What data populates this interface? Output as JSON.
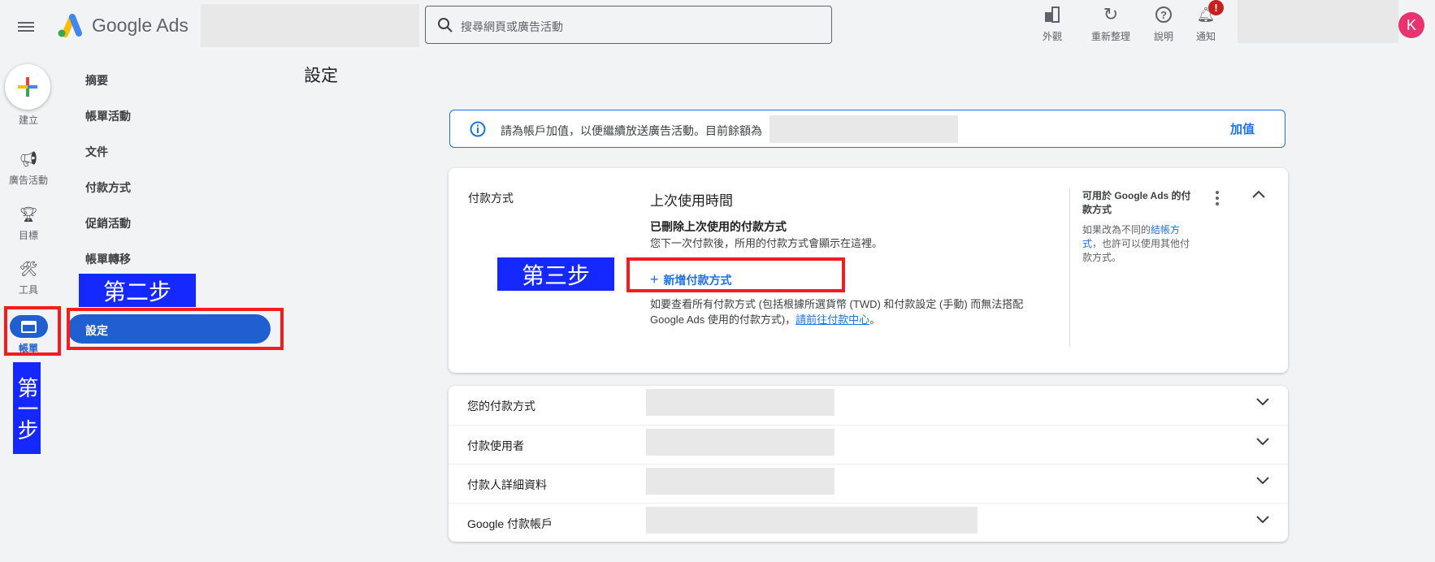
{
  "header": {
    "app_name": "Google Ads",
    "search_placeholder": "搜尋網頁或廣告活動",
    "actions": [
      {
        "label": "外觀",
        "icon": "appearance-icon"
      },
      {
        "label": "重新整理",
        "icon": "refresh-icon"
      },
      {
        "label": "說明",
        "icon": "help-icon"
      },
      {
        "label": "通知",
        "icon": "bell-icon",
        "badge": "!"
      }
    ],
    "avatar": "K",
    "avatar_color": "#e8336e"
  },
  "rail": [
    {
      "label": "建立",
      "icon": "plus-icon"
    },
    {
      "label": "廣告活動",
      "icon": "megaphone-icon"
    },
    {
      "label": "目標",
      "icon": "trophy-icon"
    },
    {
      "label": "工具",
      "icon": "tools-icon"
    },
    {
      "label": "帳單",
      "icon": "billing-icon",
      "active": true
    }
  ],
  "submenu": [
    "摘要",
    "帳單活動",
    "文件",
    "付款方式",
    "促銷活動",
    "帳單轉移",
    "設定"
  ],
  "annotations": {
    "step1": "第一步",
    "step2": "第二步",
    "step3": "第三步"
  },
  "page_title": "設定",
  "banner": {
    "text": "請為帳戶加值，以便繼續放送廣告活動。目前餘額為",
    "action": "加值"
  },
  "payment_card": {
    "section_label": "付款方式",
    "heading": "上次使用時間",
    "deleted_title": "已刪除上次使用的付款方式",
    "deleted_desc": "您下一次付款後，所用的付款方式會顯示在這裡。",
    "add_button": "新增付款方式",
    "note_part1": "如要查看所有付款方式 (包括根據所選貨幣 (TWD) 和付款設定 (手動) 而無法搭配 Google Ads 使用的付款方式)，",
    "note_link": "請前往付款中心",
    "note_end": "。",
    "side_title": "可用於 Google Ads 的付款方式",
    "side_text1": "如果改為不同的",
    "side_link": "結帳方式",
    "side_text2": "，也許可以使用其他付款方式。"
  },
  "rows": [
    "您的付款方式",
    "付款使用者",
    "付款人詳細資料",
    "Google 付款帳戶"
  ],
  "colors": {
    "accent": "#1a73e8",
    "active": "#1f5fcf",
    "annotation_blue": "#1428ff",
    "annotation_red": "#f41c1c"
  }
}
